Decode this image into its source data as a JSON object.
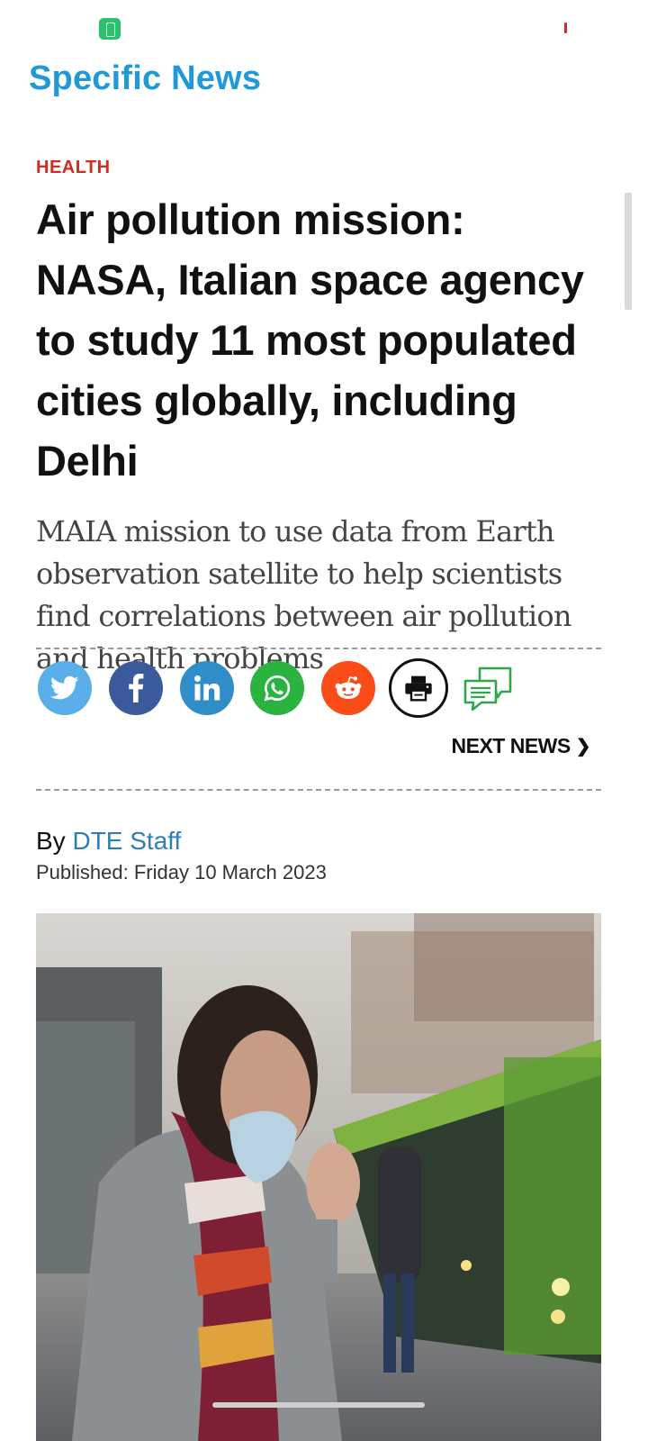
{
  "app": {
    "title": "Specific News"
  },
  "article": {
    "category": "HEALTH",
    "headline": "Air pollution mission: NASA, Italian space agency to study 11 most populated cities globally, including Delhi",
    "subheadline": "MAIA mission to use data from Earth observation satellite to help scientists find correlations between air pollution and health problems",
    "byline_prefix": "By",
    "author": "DTE Staff",
    "published": "Published: Friday 10 March 2023",
    "hero_image_icon": "photo-woman-coughing-mask-street-bus"
  },
  "share": {
    "buttons": [
      {
        "name": "twitter",
        "icon": "twitter-icon",
        "color": "#5aaeea"
      },
      {
        "name": "facebook",
        "icon": "facebook-icon",
        "color": "#3a5a9b"
      },
      {
        "name": "linkedin",
        "icon": "linkedin-icon",
        "color": "#2f8dc8"
      },
      {
        "name": "whatsapp",
        "icon": "whatsapp-icon",
        "color": "#2ab33e"
      },
      {
        "name": "reddit",
        "icon": "reddit-icon",
        "color": "#fa4c16"
      },
      {
        "name": "print",
        "icon": "print-icon",
        "color": "#111111"
      },
      {
        "name": "comments",
        "icon": "comments-icon",
        "color": "#2fa84a"
      }
    ]
  },
  "navigation": {
    "next_label": "NEXT NEWS",
    "next_chevron": "❯"
  },
  "colors": {
    "brand": "#1f9ad6",
    "category": "#d22b20",
    "author_link": "#2a7fb8"
  }
}
